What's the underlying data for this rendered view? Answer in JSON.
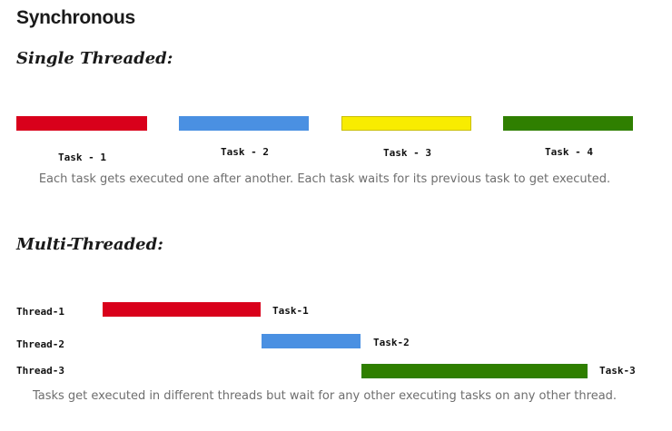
{
  "title": "Synchronous",
  "single": {
    "heading": "Single Threaded:",
    "tasks": [
      {
        "label": "Task - 1",
        "color": "#d9001b"
      },
      {
        "label": "Task - 2",
        "color": "#4a90e2"
      },
      {
        "label": "Task - 3",
        "color": "#f8ec00"
      },
      {
        "label": "Task - 4",
        "color": "#2f7f00"
      }
    ],
    "caption": "Each task gets executed one after another. Each task waits for its previous task to get executed."
  },
  "multi": {
    "heading": "Multi-Threaded:",
    "threads": [
      {
        "thread": "Thread-1",
        "task": "Task-1",
        "color": "#d9001b"
      },
      {
        "thread": "Thread-2",
        "task": "Task-2",
        "color": "#4a90e2"
      },
      {
        "thread": "Thread-3",
        "task": "Task-3",
        "color": "#2f7f00"
      }
    ],
    "caption": "Tasks get executed in different threads but wait for any other executing tasks on any other thread."
  }
}
